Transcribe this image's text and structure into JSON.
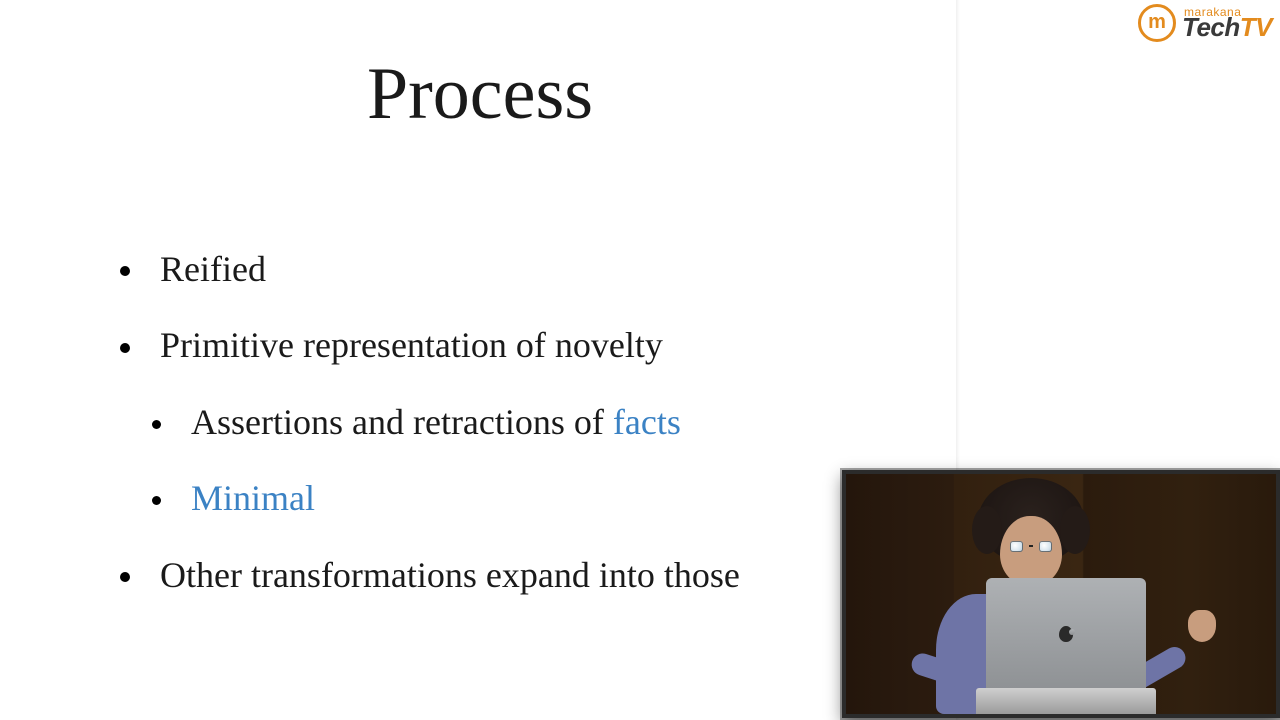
{
  "logo": {
    "top_word": "marakana",
    "brand_part1": "Tech",
    "brand_part2": "TV",
    "icon_letter": "m"
  },
  "slide": {
    "title": "Process",
    "bullets": {
      "b1": "Reified",
      "b2": "Primitive representation of novelty",
      "b2a_prefix": "Assertions and retractions of ",
      "b2a_highlight": "facts",
      "b2b_highlight": "Minimal",
      "b3": "Other transformations expand into those"
    }
  },
  "colors": {
    "highlight": "#3b82c4",
    "brand_orange": "#e38b1e"
  }
}
